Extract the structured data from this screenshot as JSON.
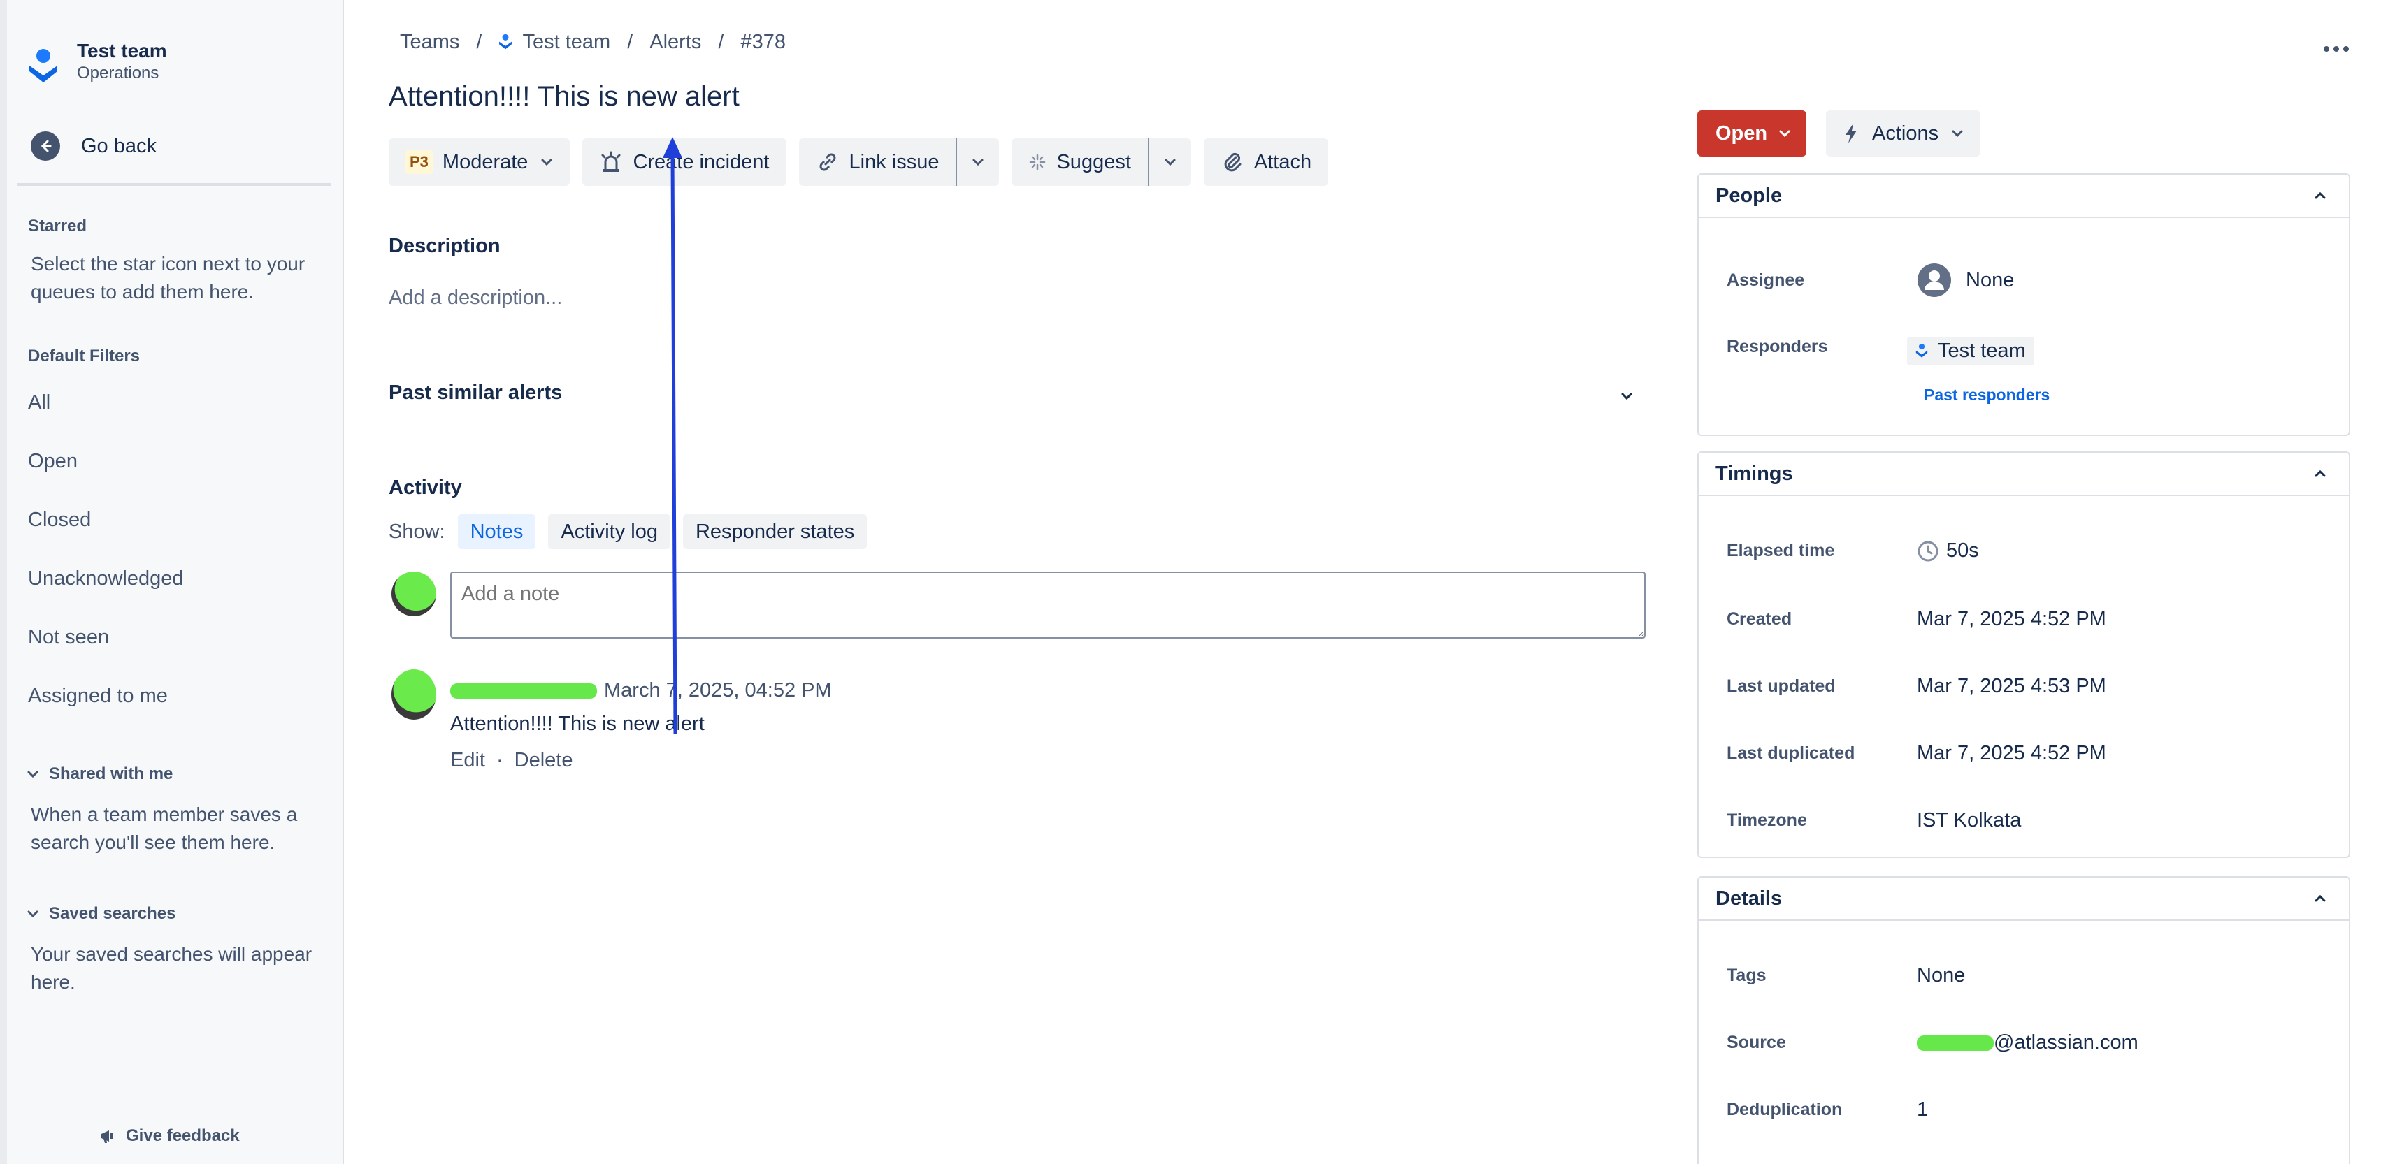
{
  "sidebar": {
    "team_name": "Test team",
    "team_sub": "Operations",
    "go_back": "Go back",
    "starred_heading": "Starred",
    "starred_text": "Select the star icon next to your queues to add them here.",
    "filters_heading": "Default Filters",
    "filters": [
      "All",
      "Open",
      "Closed",
      "Unacknowledged",
      "Not seen",
      "Assigned to me"
    ],
    "shared_heading": "Shared with me",
    "shared_text": "When a team member saves a search you'll see them here.",
    "saved_heading": "Saved searches",
    "saved_text": "Your saved searches will appear here.",
    "feedback": "Give feedback"
  },
  "breadcrumb": {
    "teams": "Teams",
    "team": "Test team",
    "alerts": "Alerts",
    "id": "#378",
    "sep": "/"
  },
  "alert": {
    "title": "Attention!!!! This is new alert",
    "priority_badge": "P3",
    "priority_label": "Moderate",
    "create_incident": "Create incident",
    "link_issue": "Link issue",
    "suggest": "Suggest",
    "attach": "Attach"
  },
  "description": {
    "heading": "Description",
    "placeholder": "Add a description..."
  },
  "similar": {
    "heading": "Past similar alerts"
  },
  "activity": {
    "heading": "Activity",
    "show_label": "Show:",
    "tabs": [
      "Notes",
      "Activity log",
      "Responder states"
    ],
    "note_placeholder": "Add a note",
    "note_date": "March 7, 2025, 04:52 PM",
    "note_text": "Attention!!!! This is new alert",
    "edit": "Edit",
    "dot": "·",
    "delete": "Delete"
  },
  "status": {
    "label": "Open",
    "actions": "Actions"
  },
  "people": {
    "title": "People",
    "assignee_key": "Assignee",
    "assignee_val": "None",
    "responders_key": "Responders",
    "responders_val": "Test team",
    "past_responders": "Past responders"
  },
  "timings": {
    "title": "Timings",
    "elapsed_key": "Elapsed time",
    "elapsed_val": "50s",
    "created_key": "Created",
    "created_val": "Mar 7, 2025 4:52 PM",
    "updated_key": "Last updated",
    "updated_val": "Mar 7, 2025 4:53 PM",
    "duplicated_key": "Last duplicated",
    "duplicated_val": "Mar 7, 2025 4:52 PM",
    "timezone_key": "Timezone",
    "timezone_val": "IST Kolkata"
  },
  "details": {
    "title": "Details",
    "tags_key": "Tags",
    "tags_val": "None",
    "source_key": "Source",
    "source_val": "@atlassian.com",
    "dedup_key": "Deduplication",
    "dedup_val": "1"
  },
  "colors": {
    "accent": "#0C66E4",
    "status_open": "#C9372C",
    "annotation": "#1F3FD8"
  }
}
